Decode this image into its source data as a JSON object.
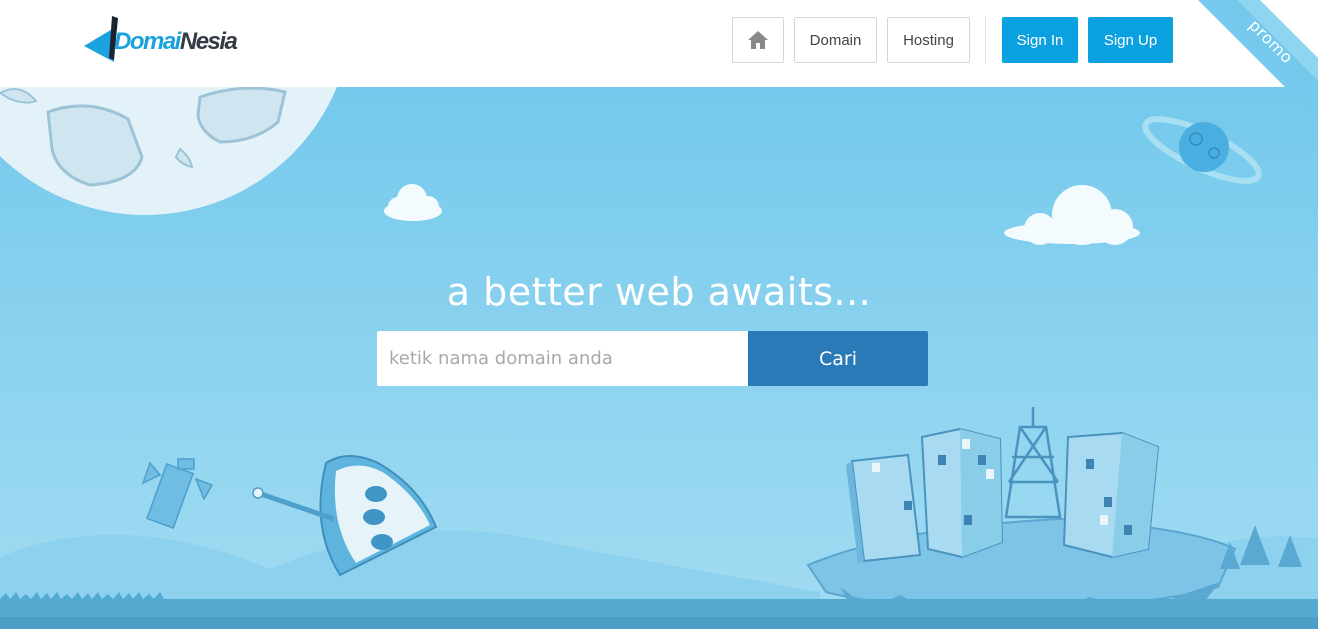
{
  "brand": {
    "part1": "Domai",
    "part2": "Nesia"
  },
  "nav": {
    "home_icon": "home-icon",
    "domain_label": "Domain",
    "hosting_label": "Hosting",
    "signin_label": "Sign In",
    "signup_label": "Sign Up"
  },
  "promo": {
    "label": "promo"
  },
  "hero": {
    "headline": "a better web awaits...",
    "search_placeholder": "ketik nama domain anda",
    "search_button": "Cari"
  },
  "colors": {
    "brand_blue": "#0ba1e1",
    "sky": "#78cbec",
    "search_button": "#2a7ab8",
    "logo_dark": "#333a44"
  }
}
